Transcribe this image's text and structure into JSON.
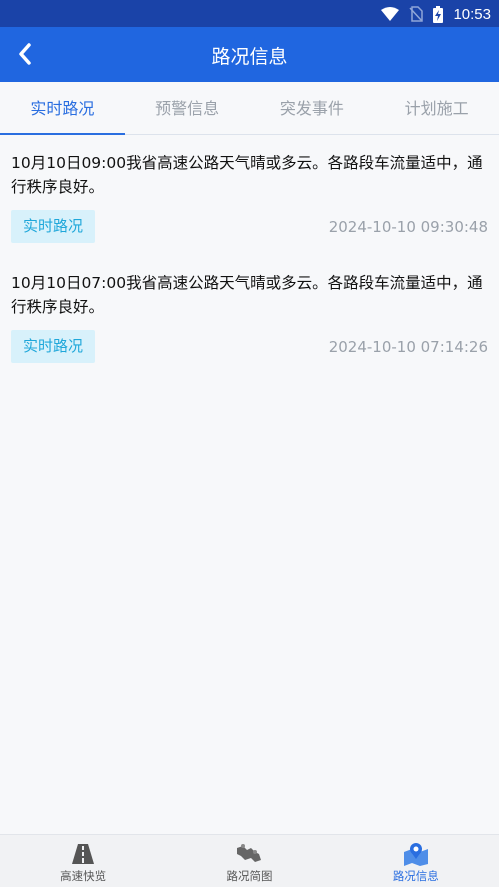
{
  "status_bar": {
    "time": "10:53"
  },
  "header": {
    "title": "路况信息"
  },
  "tabs": [
    {
      "label": "实时路况",
      "active": true
    },
    {
      "label": "预警信息",
      "active": false
    },
    {
      "label": "突发事件",
      "active": false
    },
    {
      "label": "计划施工",
      "active": false
    }
  ],
  "items": [
    {
      "text": "10月10日09:00我省高速公路天气晴或多云。各路段车流量适中，通行秩序良好。",
      "tag": "实时路况",
      "time": "2024-10-10 09:30:48"
    },
    {
      "text": "10月10日07:00我省高速公路天气晴或多云。各路段车流量适中，通行秩序良好。",
      "tag": "实时路况",
      "time": "2024-10-10 07:14:26"
    }
  ],
  "bottom_nav": [
    {
      "label": "高速快览",
      "icon": "road-icon",
      "active": false
    },
    {
      "label": "路况简图",
      "icon": "route-map-icon",
      "active": false
    },
    {
      "label": "路况信息",
      "icon": "info-map-icon",
      "active": true
    }
  ],
  "colors": {
    "status_bar": "#1a43a8",
    "header": "#2066e0",
    "accent": "#2a6ee0",
    "tag_bg": "#d8f1fb",
    "tag_text": "#1fa7da"
  }
}
